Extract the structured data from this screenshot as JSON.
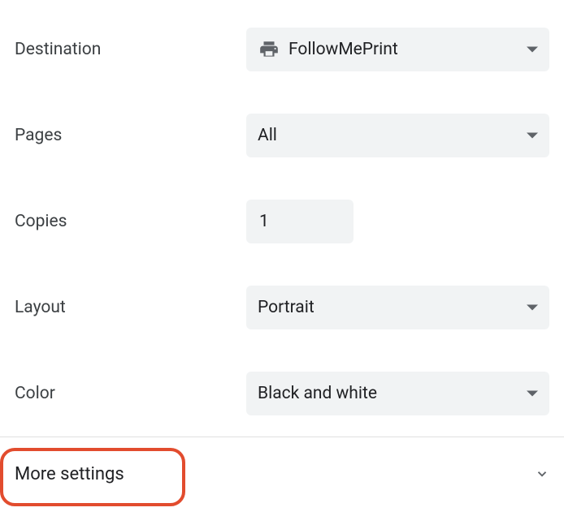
{
  "settings": {
    "destination": {
      "label": "Destination",
      "value": "FollowMePrint"
    },
    "pages": {
      "label": "Pages",
      "value": "All"
    },
    "copies": {
      "label": "Copies",
      "value": "1"
    },
    "layout": {
      "label": "Layout",
      "value": "Portrait"
    },
    "color": {
      "label": "Color",
      "value": "Black and white"
    }
  },
  "more_settings": {
    "label": "More settings"
  },
  "icons": {
    "printer": "printer-icon",
    "caret_down": "caret-down-icon",
    "chevron_down": "chevron-down-icon"
  }
}
